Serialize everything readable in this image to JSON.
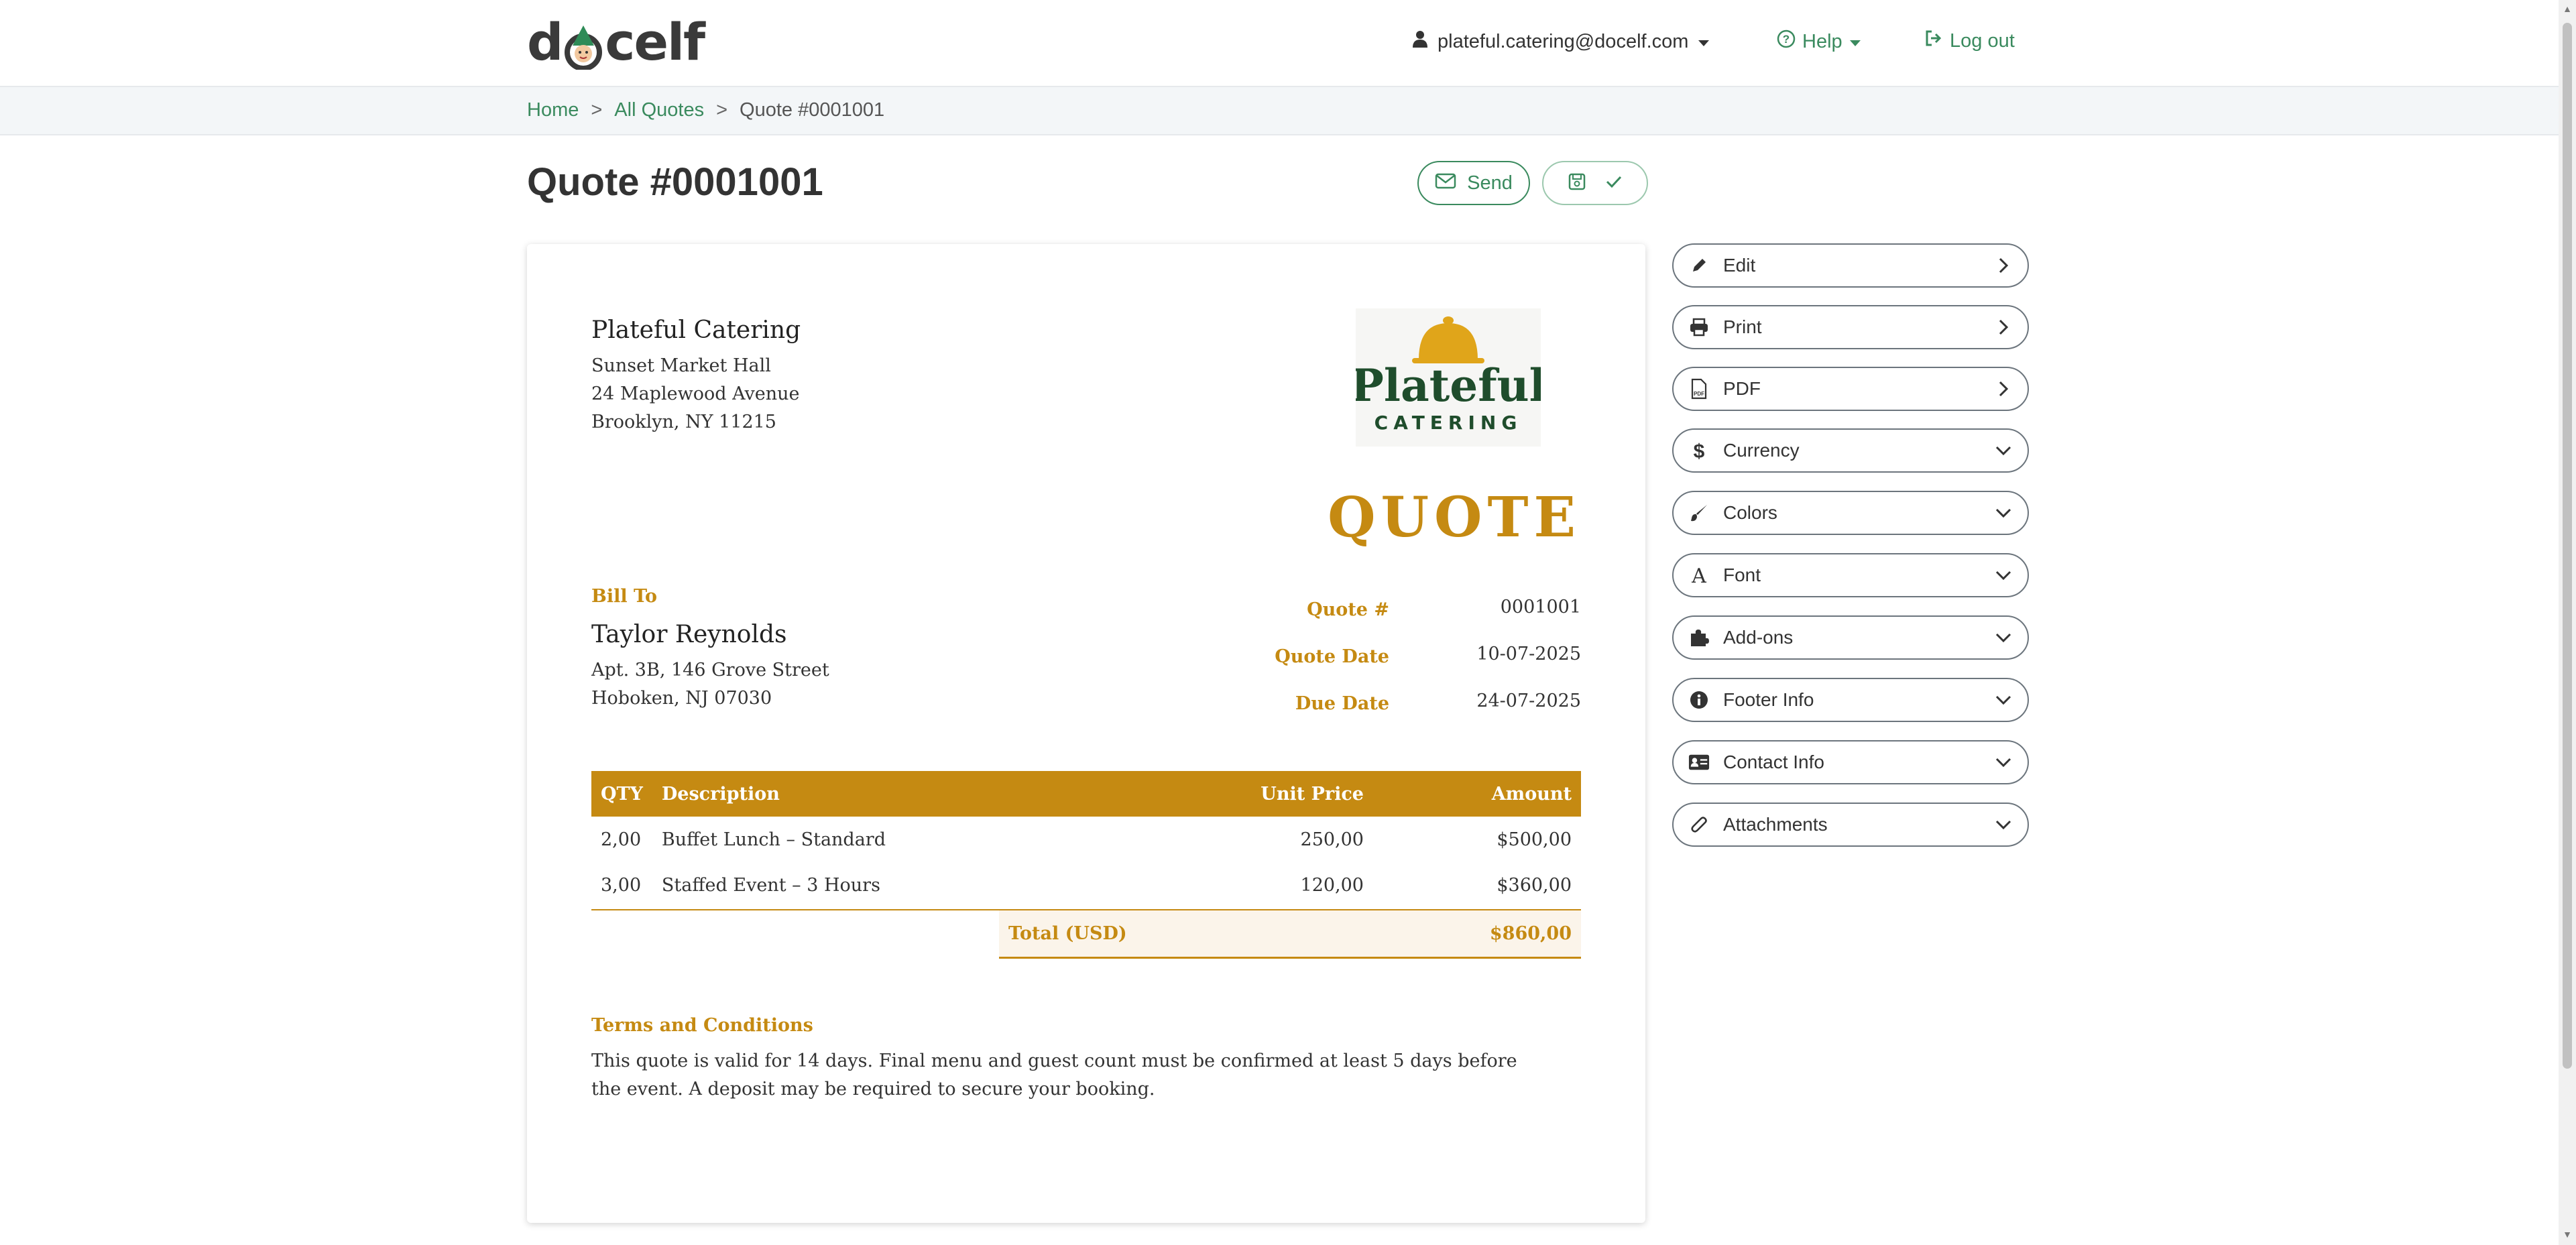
{
  "app": {
    "logo_text_left": "d",
    "logo_text_right": "celf",
    "user_email": "plateful.catering@docelf.com",
    "help_label": "Help",
    "logout_label": "Log out"
  },
  "breadcrumb": {
    "home": "Home",
    "all_quotes": "All Quotes",
    "current": "Quote #0001001",
    "separator": ">"
  },
  "page": {
    "title": "Quote #0001001",
    "send_label": "Send"
  },
  "document": {
    "company": {
      "name": "Plateful Catering",
      "lines": [
        "Sunset Market Hall",
        "24 Maplewood Avenue",
        "Brooklyn, NY 11215"
      ]
    },
    "logo": {
      "word1": "Plateful",
      "word2": "CATERING"
    },
    "doc_type": "QUOTE",
    "bill_to": {
      "label": "Bill To",
      "name": "Taylor Reynolds",
      "lines": [
        "Apt. 3B, 146 Grove Street",
        "Hoboken, NJ 07030"
      ]
    },
    "meta": [
      {
        "label": "Quote #",
        "value": "0001001"
      },
      {
        "label": "Quote Date",
        "value": "10-07-2025"
      },
      {
        "label": "Due Date",
        "value": "24-07-2025"
      }
    ],
    "table": {
      "headers": {
        "qty": "QTY",
        "description": "Description",
        "unit_price": "Unit Price",
        "amount": "Amount"
      },
      "rows": [
        {
          "qty": "2,00",
          "description": "Buffet Lunch – Standard",
          "unit_price": "250,00",
          "amount": "$500,00"
        },
        {
          "qty": "3,00",
          "description": "Staffed Event – 3 Hours",
          "unit_price": "120,00",
          "amount": "$360,00"
        }
      ],
      "total_label": "Total (USD)",
      "total_value": "$860,00"
    },
    "terms": {
      "label": "Terms and Conditions",
      "text": "This quote is valid for 14 days. Final menu and guest count must be confirmed at least 5 days before the event. A deposit may be required to secure your booking."
    }
  },
  "side_panel": [
    {
      "label": "Edit",
      "icon": "pencil-icon",
      "chevron": "chevron-right-icon"
    },
    {
      "label": "Print",
      "icon": "printer-icon",
      "chevron": "chevron-right-icon"
    },
    {
      "label": "PDF",
      "icon": "pdf-file-icon",
      "chevron": "chevron-right-icon"
    },
    {
      "label": "Currency",
      "icon": "dollar-icon",
      "chevron": "chevron-down-icon"
    },
    {
      "label": "Colors",
      "icon": "paintbrush-icon",
      "chevron": "chevron-down-icon"
    },
    {
      "label": "Font",
      "icon": "font-icon",
      "chevron": "chevron-down-icon"
    },
    {
      "label": "Add-ons",
      "icon": "puzzle-icon",
      "chevron": "chevron-down-icon"
    },
    {
      "label": "Footer Info",
      "icon": "info-icon",
      "chevron": "chevron-down-icon"
    },
    {
      "label": "Contact Info",
      "icon": "contact-card-icon",
      "chevron": "chevron-down-icon"
    },
    {
      "label": "Attachments",
      "icon": "paperclip-icon",
      "chevron": "chevron-down-icon"
    }
  ],
  "colors": {
    "accent_green": "#3a8a5e",
    "doc_gold": "#c58a12",
    "logo_green": "#1f4d2c"
  }
}
